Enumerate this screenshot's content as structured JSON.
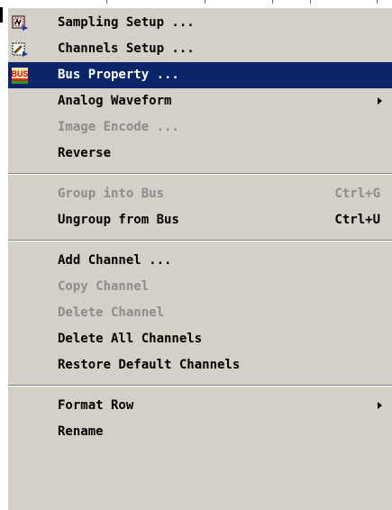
{
  "colors": {
    "menu_background": "#d4d0c8",
    "highlight": "#0a246a",
    "highlight_text": "#ffffff",
    "disabled_text": "#8c8c8c"
  },
  "menu": {
    "items": [
      {
        "label": "Sampling Setup ...",
        "icon": "sampling-setup-icon",
        "enabled": true
      },
      {
        "label": "Channels Setup ...",
        "icon": "channels-setup-icon",
        "enabled": true
      },
      {
        "label": "Bus Property ...",
        "icon": "bus-icon",
        "icon_text": "BUS",
        "enabled": true,
        "highlighted": true
      },
      {
        "label": "Analog Waveform",
        "enabled": true,
        "submenu": true
      },
      {
        "label": "Image Encode ...",
        "enabled": false
      },
      {
        "label": "Reverse",
        "enabled": true
      },
      {
        "label": "Group into Bus",
        "shortcut": "Ctrl+G",
        "enabled": false
      },
      {
        "label": "Ungroup from Bus",
        "shortcut": "Ctrl+U",
        "enabled": true
      },
      {
        "label": "Add Channel ...",
        "enabled": true
      },
      {
        "label": "Copy Channel",
        "enabled": false
      },
      {
        "label": "Delete Channel",
        "enabled": false
      },
      {
        "label": "Delete All Channels",
        "enabled": true
      },
      {
        "label": "Restore Default Channels",
        "enabled": true
      },
      {
        "label": "Format Row",
        "enabled": true,
        "submenu": true
      },
      {
        "label": "Rename",
        "enabled": true
      }
    ]
  }
}
